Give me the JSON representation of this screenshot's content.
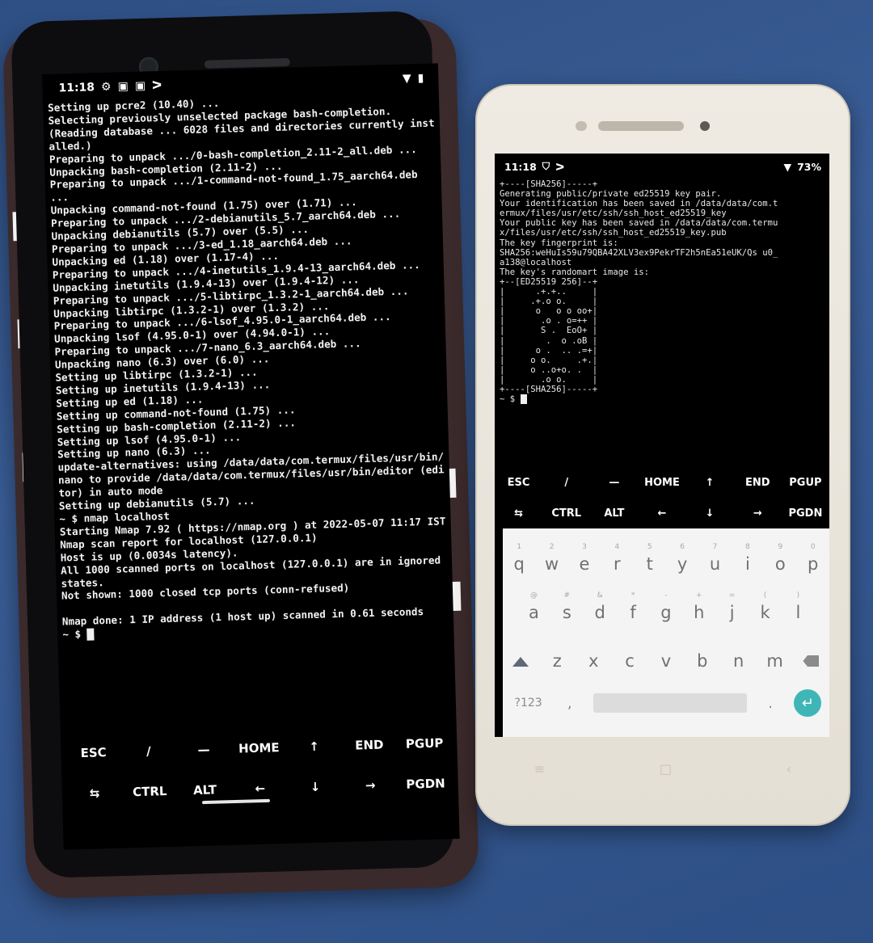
{
  "phone_left": {
    "status": {
      "time": "11:18",
      "left_icons": [
        "gear-icon",
        "sim-icon",
        "sim-icon",
        "terminal-icon"
      ],
      "right_icons": [
        "wifi-icon",
        "battery-icon"
      ]
    },
    "terminal_lines": [
      "Setting up pcre2 (10.40) ...",
      "Selecting previously unselected package bash-completion.",
      "(Reading database ... 6028 files and directories currently installed.)",
      "Preparing to unpack .../0-bash-completion_2.11-2_all.deb ...",
      "Unpacking bash-completion (2.11-2) ...",
      "Preparing to unpack .../1-command-not-found_1.75_aarch64.deb ...",
      "Unpacking command-not-found (1.75) over (1.71) ...",
      "Preparing to unpack .../2-debianutils_5.7_aarch64.deb ...",
      "Unpacking debianutils (5.7) over (5.5) ...",
      "Preparing to unpack .../3-ed_1.18_aarch64.deb ...",
      "Unpacking ed (1.18) over (1.17-4) ...",
      "Preparing to unpack .../4-inetutils_1.9.4-13_aarch64.deb ...",
      "Unpacking inetutils (1.9.4-13) over (1.9.4-12) ...",
      "Preparing to unpack .../5-libtirpc_1.3.2-1_aarch64.deb ...",
      "Unpacking libtirpc (1.3.2-1) over (1.3.2) ...",
      "Preparing to unpack .../6-lsof_4.95.0-1_aarch64.deb ...",
      "Unpacking lsof (4.95.0-1) over (4.94.0-1) ...",
      "Preparing to unpack .../7-nano_6.3_aarch64.deb ...",
      "Unpacking nano (6.3) over (6.0) ...",
      "Setting up libtirpc (1.3.2-1) ...",
      "Setting up inetutils (1.9.4-13) ...",
      "Setting up ed (1.18) ...",
      "Setting up command-not-found (1.75) ...",
      "Setting up bash-completion (2.11-2) ...",
      "Setting up lsof (4.95.0-1) ...",
      "Setting up nano (6.3) ...",
      "update-alternatives: using /data/data/com.termux/files/usr/bin/nano to provide /data/data/com.termux/files/usr/bin/editor (editor) in auto mode",
      "Setting up debianutils (5.7) ...",
      "~ $ nmap localhost",
      "Starting Nmap 7.92 ( https://nmap.org ) at 2022-05-07 11:17 IST",
      "Nmap scan report for localhost (127.0.0.1)",
      "Host is up (0.0034s latency).",
      "All 1000 scanned ports on localhost (127.0.0.1) are in ignored states.",
      "Not shown: 1000 closed tcp ports (conn-refused)",
      "",
      "Nmap done: 1 IP address (1 host up) scanned in 0.61 seconds"
    ],
    "prompt": "~ $",
    "keys_row1": [
      "ESC",
      "/",
      "—",
      "HOME",
      "↑",
      "END",
      "PGUP"
    ],
    "keys_row2": [
      "⇆",
      "CTRL",
      "ALT",
      "←",
      "↓",
      "→",
      "PGDN"
    ]
  },
  "phone_right": {
    "status": {
      "time": "11:18",
      "battery": "73%",
      "left_icons": [
        "shield-icon",
        "terminal-icon"
      ]
    },
    "terminal_lines": [
      "+----[SHA256]-----+",
      "Generating public/private ed25519 key pair.",
      "Your identification has been saved in /data/data/com.t",
      "ermux/files/usr/etc/ssh/ssh_host_ed25519_key",
      "Your public key has been saved in /data/data/com.termu",
      "x/files/usr/etc/ssh/ssh_host_ed25519_key.pub",
      "The key fingerprint is:",
      "SHA256:weHuIs59u79QBA42XLV3ex9PekrTF2h5nEa51eUK/Qs u0_",
      "a138@localhost",
      "The key's randomart image is:",
      "+--[ED25519 256]--+",
      "|      .+.+..     |",
      "|     .+.o o.     |",
      "|      o   o o oo+|",
      "|       .o . o=++ |",
      "|       S .  EoO+ |",
      "|        .  o .oB |",
      "|      o .  .. .=+|",
      "|     o o.     .+.|",
      "|     o ..o+o. .  |",
      "|       .o o.     |",
      "+----[SHA256]-----+"
    ],
    "prompt": "~ $",
    "keys_row1": [
      "ESC",
      "/",
      "—",
      "HOME",
      "↑",
      "END",
      "PGUP"
    ],
    "keys_row2": [
      "⇆",
      "CTRL",
      "ALT",
      "←",
      "↓",
      "→",
      "PGDN"
    ],
    "keyboard": {
      "row1": [
        [
          "q",
          "1"
        ],
        [
          "w",
          "2"
        ],
        [
          "e",
          "3"
        ],
        [
          "r",
          "4"
        ],
        [
          "t",
          "5"
        ],
        [
          "y",
          "6"
        ],
        [
          "u",
          "7"
        ],
        [
          "i",
          "8"
        ],
        [
          "o",
          "9"
        ],
        [
          "p",
          "0"
        ]
      ],
      "row2": [
        [
          "a",
          "@"
        ],
        [
          "s",
          "#"
        ],
        [
          "d",
          "&"
        ],
        [
          "f",
          "*"
        ],
        [
          "g",
          "-"
        ],
        [
          "h",
          "+"
        ],
        [
          "j",
          "="
        ],
        [
          "k",
          "("
        ],
        [
          "l",
          ")"
        ]
      ],
      "row3": [
        "z",
        "x",
        "c",
        "v",
        "b",
        "n",
        "m"
      ],
      "symbols_key": "?123",
      "comma_key": ",",
      "period_key": "."
    },
    "nav_icons": [
      "menu-icon",
      "home-icon",
      "back-icon"
    ]
  }
}
